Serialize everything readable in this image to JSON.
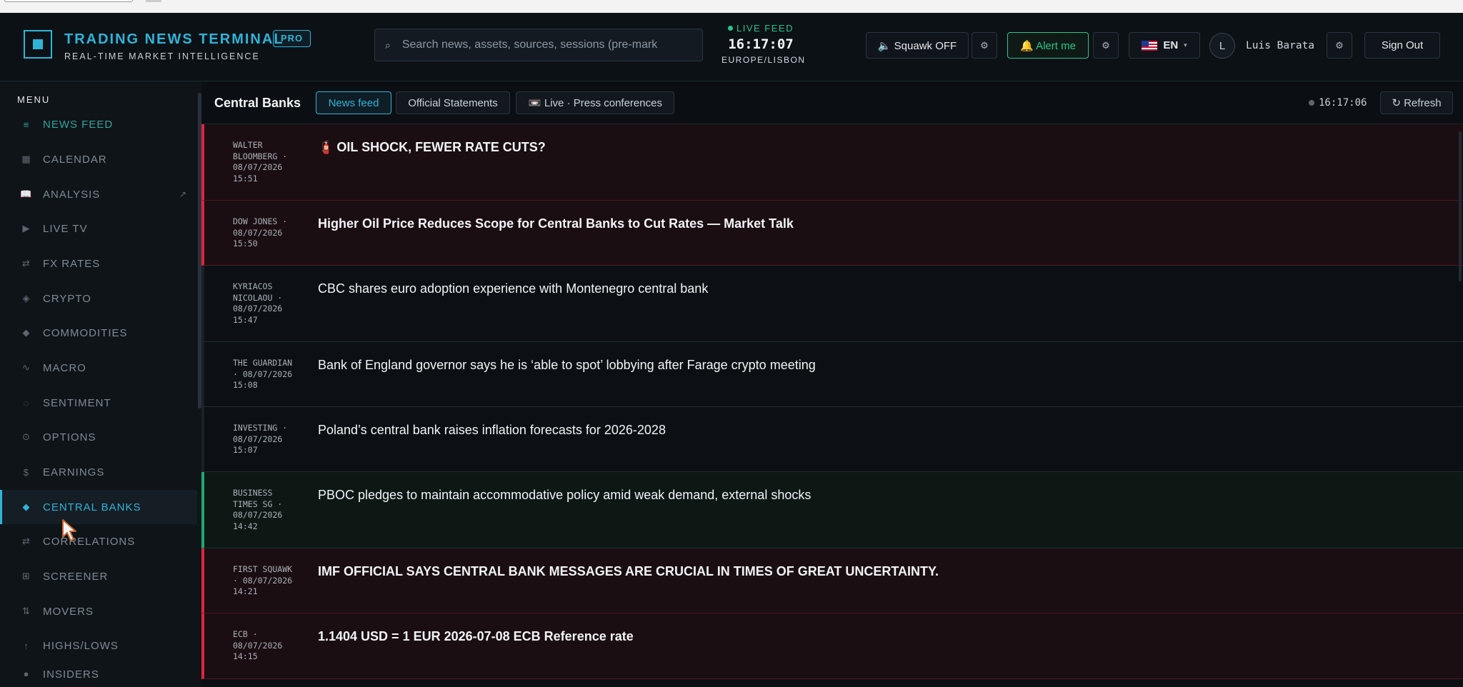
{
  "header": {
    "brand_title": "TRADING NEWS TERMINAL",
    "badge": "PRO",
    "brand_subtitle": "REAL-TIME MARKET INTELLIGENCE",
    "search_placeholder": "Search news, assets, sources, sessions (pre-mark",
    "live_label": "LIVE FEED",
    "live_time": "16:17:07",
    "timezone": "EUROPE/LISBON",
    "squawk_label": "🔈 Squawk OFF",
    "alert_label": "🔔 Alert me",
    "lang_label": "EN",
    "avatar_initial": "L",
    "username": "Luis Barata",
    "signout_label": "Sign Out",
    "gear_glyph": "⚙",
    "chevron_glyph": "▾"
  },
  "sidebar": {
    "title": "MENU",
    "items": [
      {
        "label": "NEWS FEED",
        "icon": "≡"
      },
      {
        "label": "CALENDAR",
        "icon": "▦"
      },
      {
        "label": "ANALYSIS",
        "icon": "📖",
        "ext": "↗"
      },
      {
        "label": "LIVE TV",
        "icon": "▶"
      },
      {
        "label": "FX RATES",
        "icon": "⇄"
      },
      {
        "label": "CRYPTO",
        "icon": "◈"
      },
      {
        "label": "COMMODITIES",
        "icon": "◆"
      },
      {
        "label": "MACRO",
        "icon": "∿"
      },
      {
        "label": "SENTIMENT",
        "icon": "◌"
      },
      {
        "label": "OPTIONS",
        "icon": "⊙"
      },
      {
        "label": "EARNINGS",
        "icon": "$"
      },
      {
        "label": "CENTRAL BANKS",
        "icon": "◆"
      },
      {
        "label": "CORRELATIONS",
        "icon": "⇄"
      },
      {
        "label": "SCREENER",
        "icon": "⊞"
      },
      {
        "label": "MOVERS",
        "icon": "⇅"
      },
      {
        "label": "HIGHS/LOWS",
        "icon": "↑"
      },
      {
        "label": "INSIDERS",
        "icon": "●"
      }
    ]
  },
  "main": {
    "section_title": "Central Banks",
    "tabs": [
      "News feed",
      "Official Statements",
      "📼 Live · Press conferences"
    ],
    "clock": "16:17:06",
    "refresh_label": "↻ Refresh"
  },
  "feed": [
    {
      "meta": [
        "WALTER",
        "BLOOMBERG ·",
        "08/07/2026",
        "15:51"
      ],
      "headline": "OIL SHOCK, FEWER RATE CUTS?",
      "prefix": "🧯"
    },
    {
      "meta": [
        "DOW JONES ·",
        "08/07/2026",
        "15:50"
      ],
      "headline": "Higher Oil Price Reduces Scope for Central Banks to Cut Rates — Market Talk"
    },
    {
      "meta": [
        "KYRIACOS",
        "NICOLAOU ·",
        "08/07/2026",
        "15:47"
      ],
      "headline": "CBC shares euro adoption experience with Montenegro central bank"
    },
    {
      "meta": [
        "THE GUARDIAN",
        "· 08/07/2026",
        "15:08"
      ],
      "headline": "Bank of England governor says he is ‘able to spot’ lobbying after Farage crypto meeting"
    },
    {
      "meta": [
        "INVESTING ·",
        "08/07/2026",
        "15:07"
      ],
      "headline": "Poland’s central bank raises inflation forecasts for 2026-2028"
    },
    {
      "meta": [
        "BUSINESS",
        "TIMES SG ·",
        "08/07/2026",
        "14:42"
      ],
      "headline": "PBOC pledges to maintain accommodative policy amid weak demand, external shocks"
    },
    {
      "meta": [
        "FIRST SQUAWK",
        "· 08/07/2026",
        "14:21"
      ],
      "headline": "IMF OFFICIAL SAYS CENTRAL BANK MESSAGES ARE CRUCIAL IN TIMES OF GREAT UNCERTAINTY."
    },
    {
      "meta": [
        "ECB ·",
        "08/07/2026",
        "14:15"
      ],
      "headline": "1.1404 USD = 1 EUR 2026-07-08 ECB Reference rate"
    }
  ]
}
